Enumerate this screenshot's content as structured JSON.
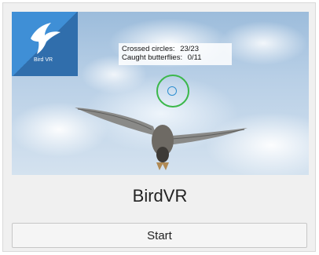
{
  "app": {
    "title": "BirdVR",
    "logo_caption": "Bird VR",
    "logo_icon": "flying-bird-icon"
  },
  "hud": {
    "crossed_circles_label": "Crossed circles:",
    "crossed_circles_value": "23/23",
    "caught_butterflies_label": "Caught butterflies:",
    "caught_butterflies_value": "0/11"
  },
  "actions": {
    "start_label": "Start"
  },
  "colors": {
    "logo_background": "#3f8fd6",
    "target_ring": "#3cb84b",
    "target_dot": "#2f8fd0"
  }
}
